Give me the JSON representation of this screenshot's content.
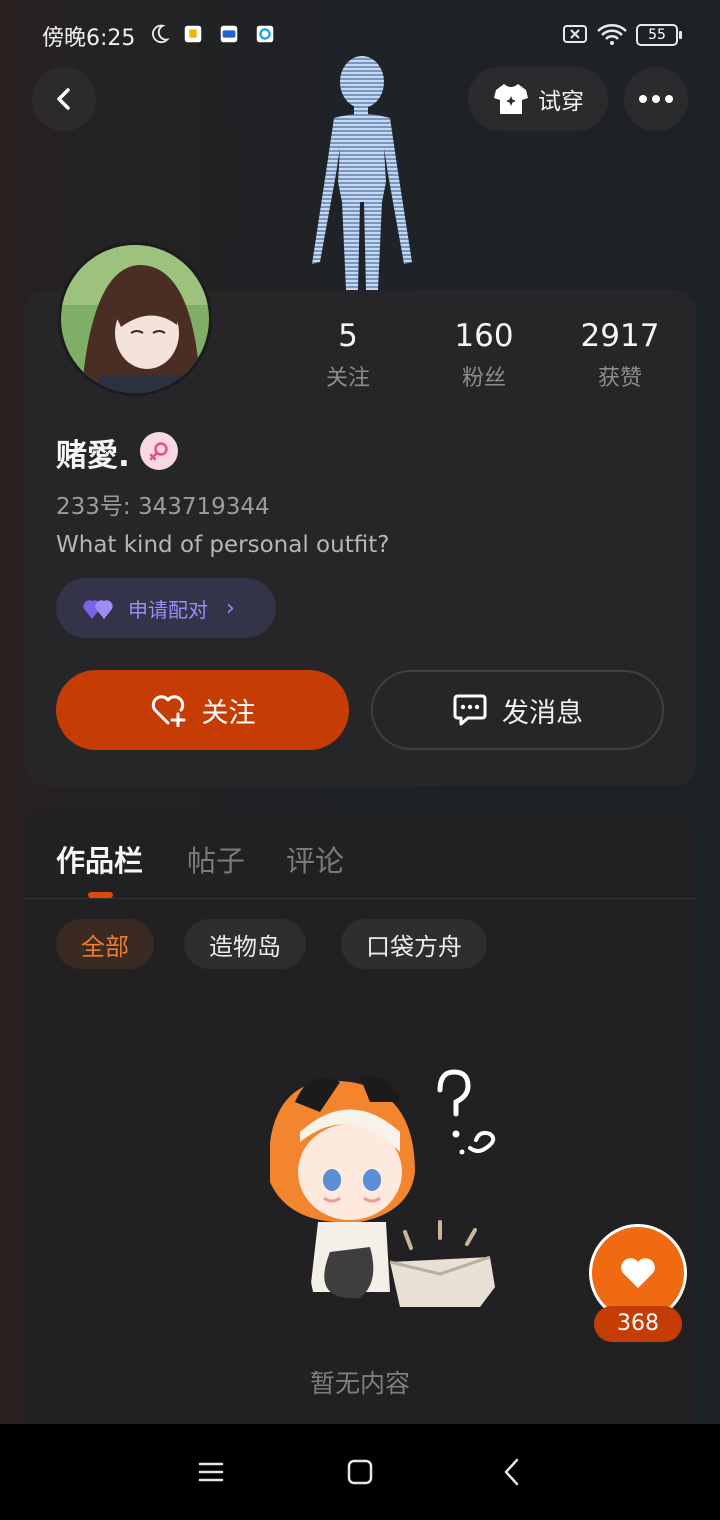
{
  "status_bar": {
    "time": "傍晚6:25",
    "battery": "55"
  },
  "header": {
    "tryon_label": "试穿"
  },
  "profile": {
    "username": "赌愛.",
    "uid_text": "233号: 343719344",
    "bio": "What kind of personal outfit?",
    "pair_label": "申请配对",
    "stats": [
      {
        "num": "5",
        "label": "关注"
      },
      {
        "num": "160",
        "label": "粉丝"
      },
      {
        "num": "2917",
        "label": "获赞"
      }
    ],
    "follow_label": "关注",
    "message_label": "发消息"
  },
  "works": {
    "tabs": [
      "作品栏",
      "帖子",
      "评论"
    ],
    "chips": [
      "全部",
      "造物岛",
      "口袋方舟"
    ],
    "empty_text": "暂无内容"
  },
  "like_fab": {
    "count": "368"
  },
  "colors": {
    "accent": "#c53d04",
    "accent_light": "#ef6a10",
    "pair_purple": "#9d8cf4"
  }
}
